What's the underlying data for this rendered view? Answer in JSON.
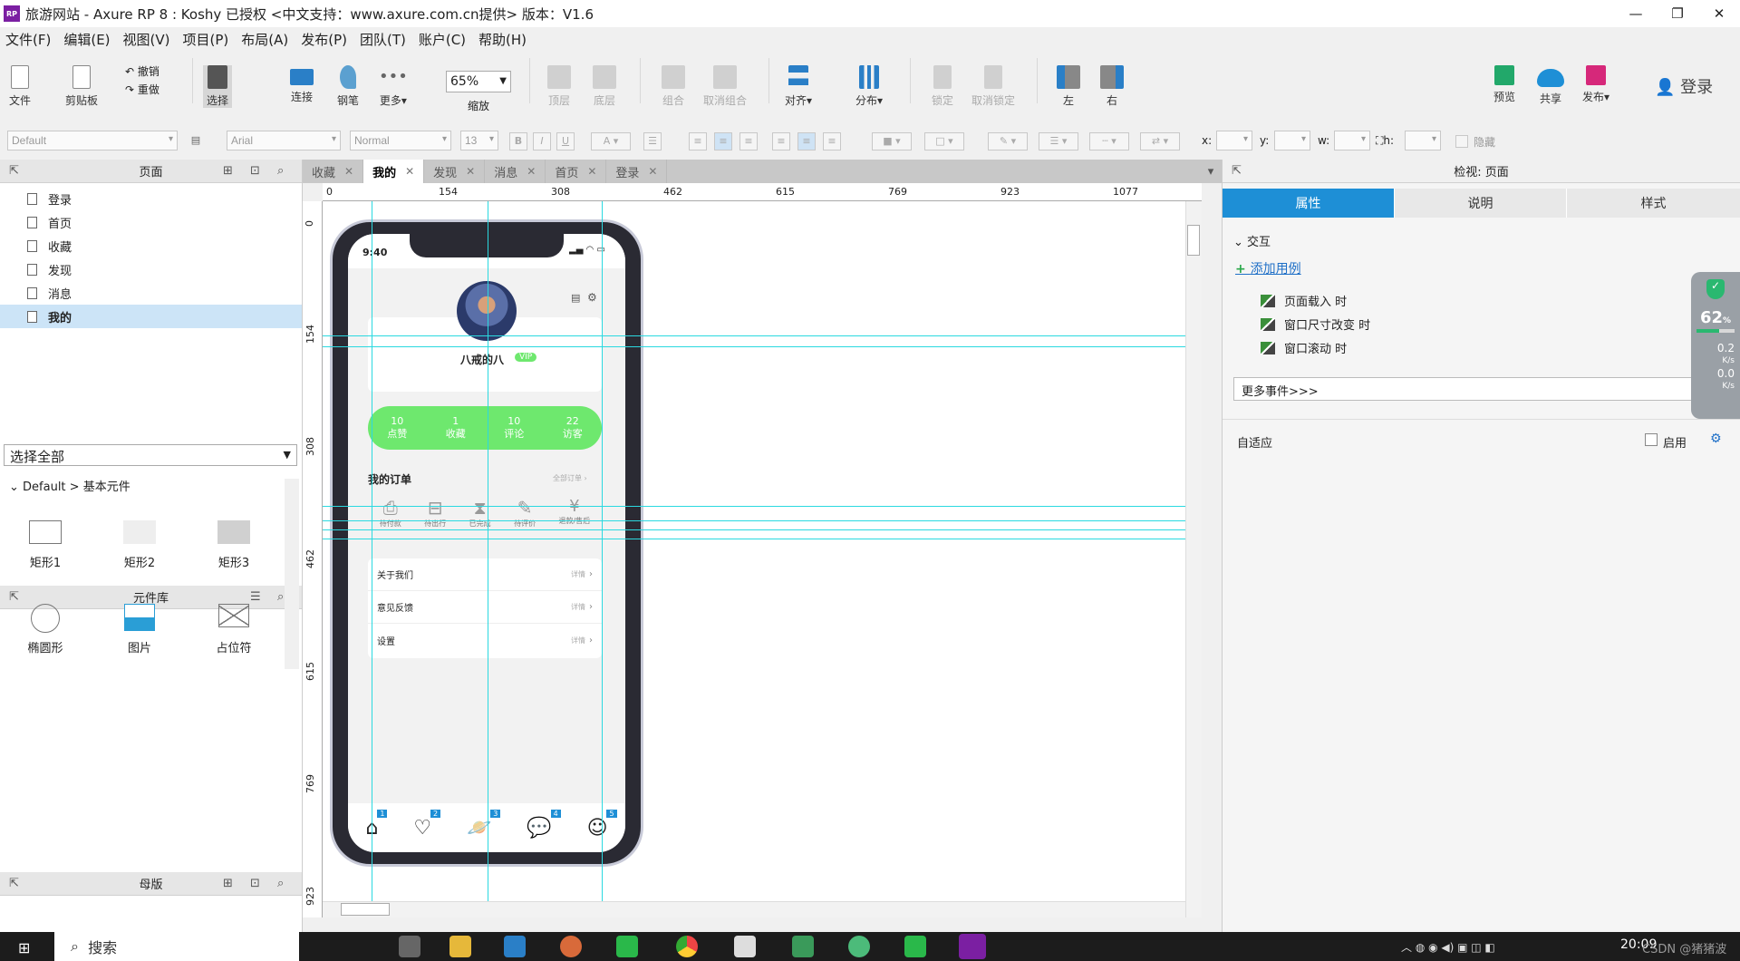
{
  "window": {
    "title": "旅游网站 - Axure RP 8 : Koshy 已授权    <中文支持：www.axure.com.cn提供> 版本：V1.6",
    "logo": "RP"
  },
  "menu": [
    "文件(F)",
    "编辑(E)",
    "视图(V)",
    "项目(P)",
    "布局(A)",
    "发布(P)",
    "团队(T)",
    "账户(C)",
    "帮助(H)"
  ],
  "toolbar": {
    "file": "文件",
    "clipboard": "剪贴板",
    "undo": "撤销",
    "redo": "重做",
    "select": "选择",
    "connect": "连接",
    "pen": "钢笔",
    "more": "更多▾",
    "zoom_value": "65%",
    "zoom_label": "缩放",
    "top": "顶层",
    "bottom": "底层",
    "group": "组合",
    "ungroup": "取消组合",
    "align": "对齐▾",
    "distribute": "分布▾",
    "lock": "锁定",
    "unlock": "取消锁定",
    "left": "左",
    "right": "右",
    "preview": "预览",
    "share": "共享",
    "publish": "发布▾",
    "login": "登录"
  },
  "format": {
    "style": "Default",
    "font": "Arial",
    "weight": "Normal",
    "size": "13",
    "x": "x:",
    "y": "y:",
    "w": "w:",
    "h": "h:",
    "hidden": "隐藏"
  },
  "pages_panel": {
    "title": "页面",
    "items": [
      "登录",
      "首页",
      "收藏",
      "发现",
      "消息",
      "我的"
    ],
    "selected": 5
  },
  "library_panel": {
    "title": "元件库",
    "select": "选择全部",
    "group": "Default > 基本元件",
    "widgets": [
      "矩形1",
      "矩形2",
      "矩形3",
      "椭圆形",
      "图片",
      "占位符"
    ]
  },
  "masters_panel": {
    "title": "母版"
  },
  "tabs": [
    {
      "label": "收藏"
    },
    {
      "label": "我的"
    },
    {
      "label": "发现"
    },
    {
      "label": "消息"
    },
    {
      "label": "首页"
    },
    {
      "label": "登录"
    }
  ],
  "active_tab": 1,
  "ruler": {
    "h": [
      "0",
      "154",
      "308",
      "462",
      "615",
      "769",
      "923",
      "1077"
    ],
    "v": [
      "0",
      "154",
      "308",
      "462",
      "615",
      "769",
      "923"
    ]
  },
  "phone": {
    "time": "9:40",
    "username": "八戒的八",
    "vip": "VIP",
    "stats": [
      {
        "n": "10",
        "l": "点赞"
      },
      {
        "n": "1",
        "l": "收藏"
      },
      {
        "n": "10",
        "l": "评论"
      },
      {
        "n": "22",
        "l": "访客"
      }
    ],
    "orders_title": "我的订单",
    "orders_all": "全部订单",
    "orders": [
      "待付款",
      "待出行",
      "已完成",
      "待评价",
      "退款/售后"
    ],
    "menu": [
      {
        "label": "关于我们",
        "hint": "详情"
      },
      {
        "label": "意见反馈",
        "hint": "详情"
      },
      {
        "label": "设置",
        "hint": "详情"
      }
    ],
    "nav_badges": [
      "1",
      "2",
      "3",
      "4",
      "5"
    ],
    "accent": "#6ee86e"
  },
  "inspector": {
    "title": "检视: 页面",
    "tabs": [
      "属性",
      "说明",
      "样式"
    ],
    "section": "交互",
    "add_case": "添加用例",
    "events": [
      "页面载入 时",
      "窗口尺寸改变 时",
      "窗口滚动 时"
    ],
    "more_events": "更多事件>>>",
    "adaptive": "自适应",
    "enable": "启用"
  },
  "monitor": {
    "percent": "62",
    "pct_sign": "%",
    "up": "0.2",
    "down": "0.0",
    "unit": "K/s"
  },
  "taskbar": {
    "search": "搜索",
    "time": "20:09",
    "watermark": "CSDN @猪猪波"
  }
}
